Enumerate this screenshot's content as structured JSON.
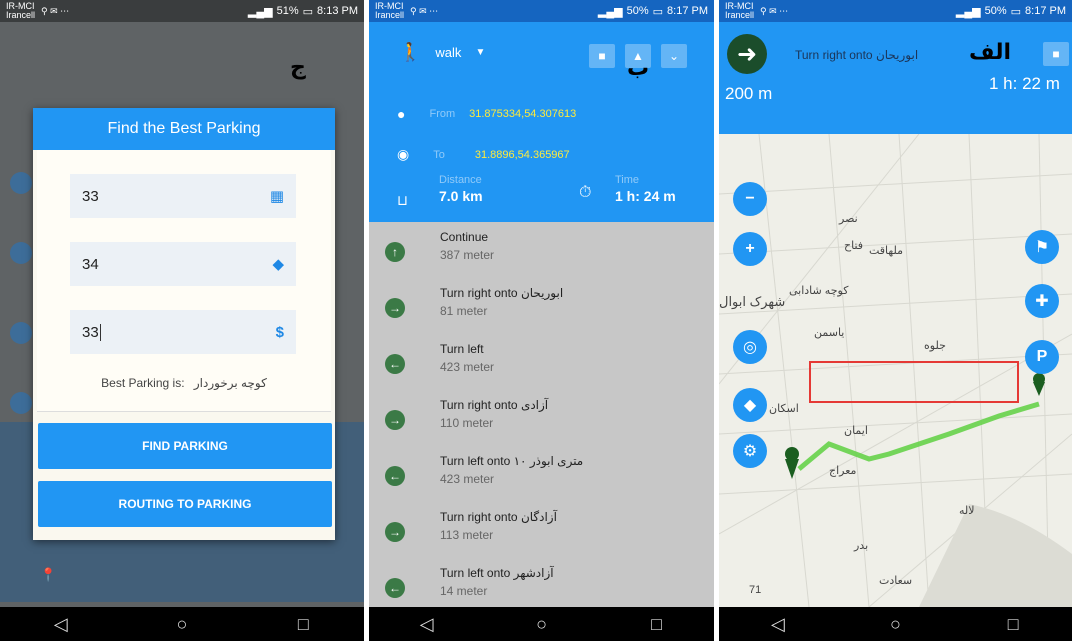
{
  "labels": {
    "j": "ج",
    "b": "ب",
    "a": "الف"
  },
  "status": {
    "carrier": "IR-MCI\nIrancell",
    "j": {
      "battery": "51%",
      "time": "8:13 PM"
    },
    "b": {
      "battery": "50%",
      "time": "8:17 PM"
    },
    "a": {
      "battery": "50%",
      "time": "8:17 PM"
    }
  },
  "dialog": {
    "title": "Find the Best Parking",
    "field1": "33",
    "field2": "34",
    "field3": "33",
    "result_label": "Best Parking is:",
    "result_value": "کوچه برخوردار",
    "find_button": "FIND PARKING",
    "routing_button": "ROUTING TO PARKING"
  },
  "route": {
    "mode": "walk",
    "from_label": "From",
    "from": "31.875334,54.307613",
    "to_label": "To",
    "to": "31.8896,54.365967",
    "distance_label": "Distance",
    "distance": "7.0 km",
    "time_label": "Time",
    "time": "1 h: 24 m",
    "steps": [
      {
        "title": "Continue",
        "dist": "387 meter",
        "icon": "↑"
      },
      {
        "title": "Turn right onto ابوریحان",
        "dist": "81 meter",
        "icon": "→"
      },
      {
        "title": "Turn left",
        "dist": "423 meter",
        "icon": "←"
      },
      {
        "title": "Turn right onto آزادی",
        "dist": "110 meter",
        "icon": "→"
      },
      {
        "title": "Turn left onto ۱۰ متری ابوذر",
        "dist": "423 meter",
        "icon": "←"
      },
      {
        "title": "Turn right onto آزادگان",
        "dist": "113 meter",
        "icon": "→"
      },
      {
        "title": "Turn left onto آزادشهر",
        "dist": "14 meter",
        "icon": "←"
      }
    ]
  },
  "nav": {
    "instruction": "Turn right onto ابوریحان",
    "distance": "200 m",
    "eta": "1 h: 22 m",
    "map_labels": {
      "l1": "شهرک ابوال",
      "l2": "معراج",
      "l3": "بدر",
      "l4": "سعادت",
      "l5": "ایمان",
      "l6": "اسکان",
      "l7": "جلوه",
      "l8": "یاسمن",
      "l9": "کوچه شادابی",
      "l10": "ملهاقت",
      "l11": "فتاح",
      "l12": "نصر",
      "l13": "لاله",
      "l14": "71"
    }
  },
  "colors": {
    "primary": "#2196f3",
    "route": "#66d24a",
    "pin": "#1b5e20"
  }
}
